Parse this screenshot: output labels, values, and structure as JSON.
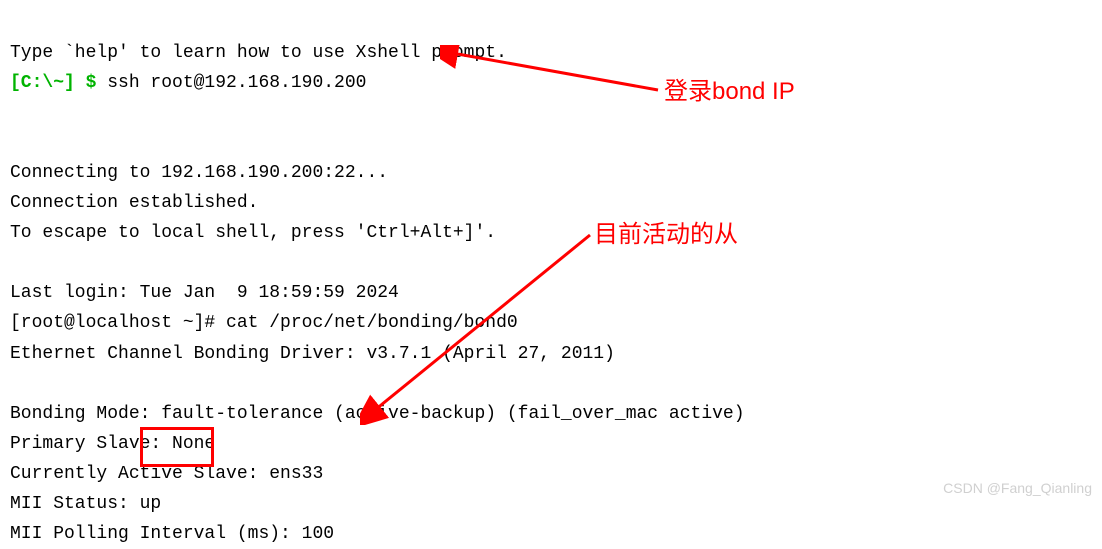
{
  "terminal": {
    "help_line": "Type `help' to learn how to use Xshell prompt.",
    "prompt_path": "[C:\\~]",
    "prompt_symbol": "$",
    "ssh_command": "ssh root@192.168.190.200",
    "connecting": "Connecting to 192.168.190.200:22...",
    "connection_established": "Connection established.",
    "escape_hint": "To escape to local shell, press 'Ctrl+Alt+]'.",
    "last_login": "Last login: Tue Jan  9 18:59:59 2024",
    "root_prompt": "[root@localhost ~]# ",
    "cat_command": "cat /proc/net/bonding/bond0",
    "driver_line": "Ethernet Channel Bonding Driver: v3.7.1 (April 27, 2011)",
    "bonding_mode": "Bonding Mode: fault-tolerance (active-backup) (fail_over_mac active)",
    "primary_slave": "Primary Slave: None",
    "active_slave": "Currently Active Slave: ens33",
    "mii_status": "MII Status: up",
    "mii_polling": "MII Polling Interval (ms): 100"
  },
  "annotations": {
    "label1": "登录bond IP",
    "label2": "目前活动的从"
  },
  "watermark": "CSDN @Fang_Qianling"
}
